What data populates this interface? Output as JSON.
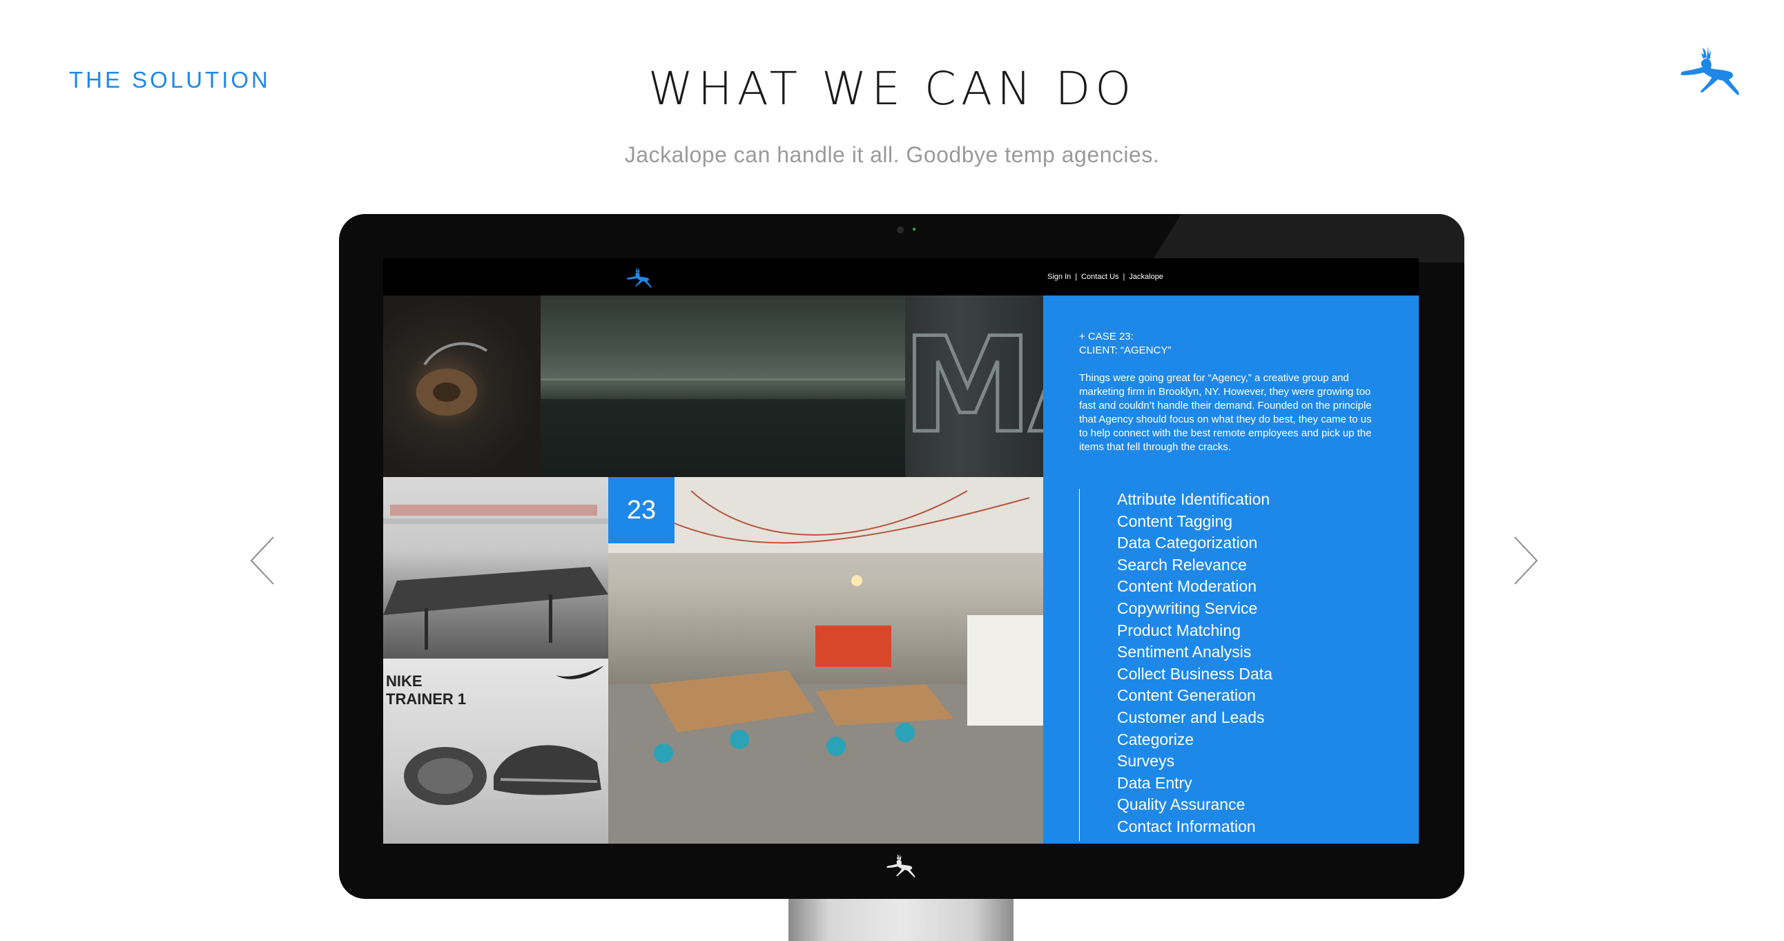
{
  "header": {
    "section_label": "THE SOLUTION",
    "title": "WHAT WE CAN DO",
    "subtitle": "Jackalope can handle it all.  Goodbye temp agencies."
  },
  "icons": {
    "brand": "jackalope-logo-icon",
    "prev": "chevron-left-icon",
    "next": "chevron-right-icon"
  },
  "colors": {
    "accent": "#1e88e8",
    "monitor": "#0b0b0b"
  },
  "screen": {
    "nav_links": [
      "Sign In",
      "Contact Us",
      "Jackalope"
    ],
    "nav_separator": "|",
    "case_number": "23",
    "case_title": "+ CASE 23:",
    "case_client": "CLIENT: “AGENCY”",
    "case_description": "Things were going great for “Agency,” a creative group and marketing firm in Brooklyn, NY.  However, they were growing too fast and couldn’t handle their demand.  Founded on the principle that Agency should focus on what they do best, they came to us to help connect with the best remote employees and pick up the items that fell through the cracks.",
    "tile_text_neon": "MA",
    "tile_text_nike": "NIKE\nTRAINER 1",
    "services": [
      "Attribute Identification",
      "Content Tagging",
      "Data Categorization",
      "Search Relevance",
      "Content Moderation",
      "Copywriting Service",
      "Product Matching",
      "Sentiment Analysis",
      "Collect Business Data",
      "Content Generation",
      "Customer and Leads",
      "Categorize",
      "Surveys",
      "Data Entry",
      "Quality Assurance",
      "Contact Information"
    ]
  }
}
